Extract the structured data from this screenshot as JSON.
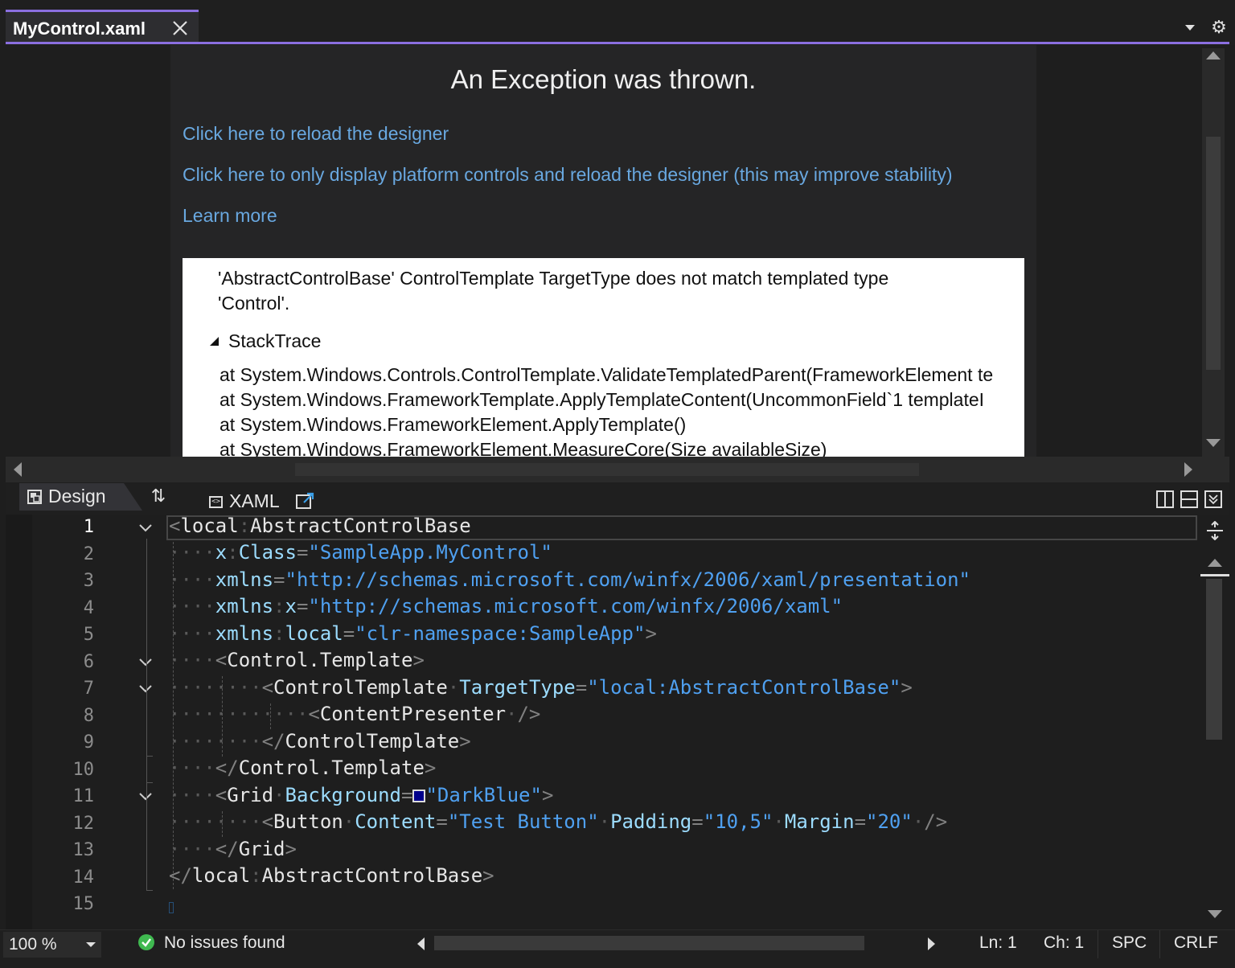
{
  "tab": {
    "title": "MyControl.xaml"
  },
  "designer": {
    "exception_title": "An Exception was thrown.",
    "links": [
      "Click here to reload the designer",
      "Click here to only display platform controls and reload the designer (this may improve stability)",
      "Learn more"
    ],
    "error_message": "'AbstractControlBase' ControlTemplate TargetType does not match templated type 'Control'.",
    "stacktrace_label": "StackTrace",
    "stacktrace_lines": [
      "at System.Windows.Controls.ControlTemplate.ValidateTemplatedParent(FrameworkElement te",
      "at System.Windows.FrameworkTemplate.ApplyTemplateContent(UncommonField`1 templateI",
      "at System.Windows.FrameworkElement.ApplyTemplate()",
      "at System.Windows.FrameworkElement.MeasureCore(Size availableSize)"
    ]
  },
  "view_tabs": {
    "design": "Design",
    "xaml": "XAML"
  },
  "editor": {
    "current_line": 1,
    "line_numbers": [
      "1",
      "2",
      "3",
      "4",
      "5",
      "6",
      "7",
      "8",
      "9",
      "10",
      "11",
      "12",
      "13",
      "14",
      "15"
    ],
    "swatch_color": "#00008B",
    "tokens": {
      "l1": [
        "local",
        "AbstractControlBase"
      ],
      "l2": [
        "x",
        "Class",
        "\"SampleApp.MyControl\""
      ],
      "l3": [
        "xmlns",
        "\"http://schemas.microsoft.com/winfx/2006/xaml/presentation\""
      ],
      "l4": [
        "xmlns",
        "x",
        "\"http://schemas.microsoft.com/winfx/2006/xaml\""
      ],
      "l5": [
        "xmlns",
        "local",
        "\"clr-namespace:SampleApp\""
      ],
      "l6": [
        "Control.Template"
      ],
      "l7": [
        "ControlTemplate",
        "TargetType",
        "\"local:AbstractControlBase\""
      ],
      "l8": [
        "ContentPresenter"
      ],
      "l9": [
        "ControlTemplate"
      ],
      "l10": [
        "Control.Template"
      ],
      "l11": [
        "Grid",
        "Background",
        "\"DarkBlue\""
      ],
      "l12": [
        "Button",
        "Content",
        "\"Test Button\"",
        "Padding",
        "\"10,5\"",
        "Margin",
        "\"20\""
      ],
      "l13": [
        "Grid"
      ],
      "l14": [
        "local",
        "AbstractControlBase"
      ]
    }
  },
  "status": {
    "zoom": "100 %",
    "issues": "No issues found",
    "ln": "Ln: 1",
    "ch": "Ch: 1",
    "spc": "SPC",
    "crlf": "CRLF"
  },
  "colors": {
    "accent": "#8B6FE0",
    "link": "#69A8E0",
    "attribute": "#9CDCFE",
    "value": "#4FA0F0",
    "ok": "#3FB950"
  }
}
